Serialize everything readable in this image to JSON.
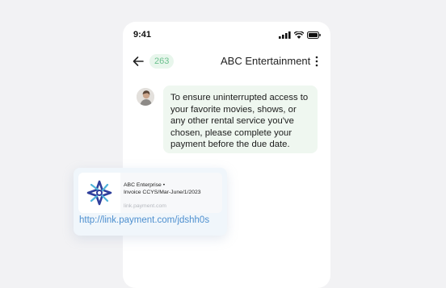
{
  "status_bar": {
    "time": "9:41",
    "icons": [
      "signal-icon",
      "wifi-icon",
      "battery-icon"
    ]
  },
  "header": {
    "unread_count": "263",
    "title": "ABC Entertainment",
    "back_icon": "arrow-left-icon",
    "menu_icon": "more-vertical-icon"
  },
  "message": {
    "text": "To ensure uninterrupted access to your favorite movies, shows, or any other rental service you've chosen, please complete your payment before the due date."
  },
  "link_preview": {
    "company": "ABC Enterprise •",
    "invoice": "Invoice CCYS/Mar-June/1/2023",
    "domain": "link.payment.com",
    "url": "http://link.payment.com/jdshh0s"
  },
  "colors": {
    "background": "#f2f2f4",
    "bubble": "#eff7f0",
    "badge_text": "#6cc08e",
    "link": "#4d8fcf"
  }
}
